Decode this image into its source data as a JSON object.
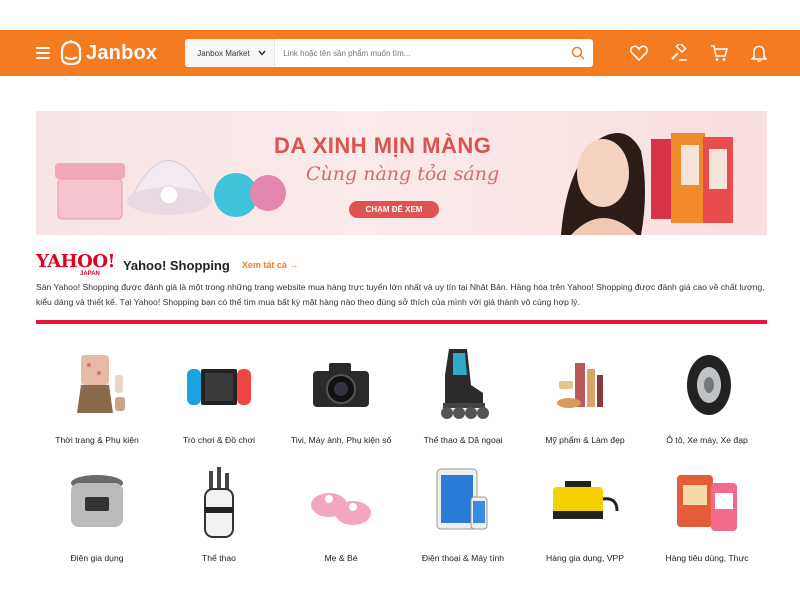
{
  "header": {
    "logo_text": "Janbox",
    "search": {
      "store_select": "Janbox Market",
      "placeholder": "Link hoặc tên sản phẩm muốn tìm..."
    },
    "icons": [
      "heart-icon",
      "auction-hammer-icon",
      "cart-icon",
      "bell-icon"
    ]
  },
  "banner": {
    "title": "DA XINH MỊN MÀNG",
    "subtitle": "Cùng nàng tỏa sáng",
    "button": "CHẠM ĐỂ XEM"
  },
  "section": {
    "logo_main": "YAHOO!",
    "logo_sub": "JAPAN",
    "title": "Yahoo! Shopping",
    "see_all": "Xem tất cả",
    "description": "Sàn Yahoo! Shopping được đánh giá là một trong những trang website mua hàng trực tuyến lớn nhất và uy tín tại Nhật Bản. Hàng hóa trên Yahoo! Shopping được đánh giá cao về chất lượng, kiểu dáng và thiết kế. Tại Yahoo! Shopping bạn có thể tìm mua bất kỳ mặt hàng nào theo đúng sở thích của mình với giá thành vô cùng hợp lý."
  },
  "categories": [
    {
      "label": "Thời trang & Phụ kiện",
      "icon": "fashion-icon"
    },
    {
      "label": "Trò chơi & Đồ chơi",
      "icon": "game-console-icon"
    },
    {
      "label": "Tivi, Máy ảnh, Phụ kiện số",
      "icon": "camera-icon"
    },
    {
      "label": "Thể thao & Dã ngoại",
      "icon": "roller-skate-icon"
    },
    {
      "label": "Mỹ phẩm & Làm đẹp",
      "icon": "cosmetics-icon"
    },
    {
      "label": "Ô tô, Xe máy, Xe đạp",
      "icon": "tire-icon"
    },
    {
      "label": "Điện gia dụng",
      "icon": "rice-cooker-icon"
    },
    {
      "label": "Thể thao",
      "icon": "golf-bag-icon"
    },
    {
      "label": "Mẹ & Bé",
      "icon": "baby-shoes-icon"
    },
    {
      "label": "Điện thoại & Máy tính",
      "icon": "tablet-phone-icon"
    },
    {
      "label": "Hàng gia dụng, VPP",
      "icon": "pressure-washer-icon"
    },
    {
      "label": "Hàng tiêu dùng, Thực",
      "icon": "snack-icon"
    }
  ],
  "colors": {
    "brand_orange": "#f47b20",
    "yahoo_red": "#e00020",
    "divider_red": "#e8123c"
  }
}
